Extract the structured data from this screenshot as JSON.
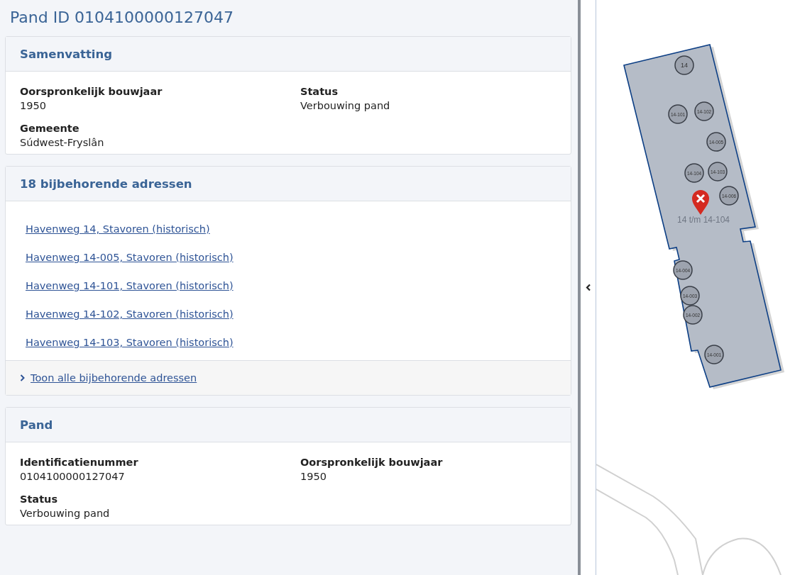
{
  "title": "Pand ID 0104100000127047",
  "sections": [
    {
      "title": "Samenvatting",
      "kind": "fields",
      "fields": [
        {
          "label": "Oorspronkelijk bouwjaar",
          "value": "1950"
        },
        {
          "label": "Status",
          "value": "Verbouwing pand"
        },
        {
          "label": "Gemeente",
          "value": "Súdwest-Fryslân"
        }
      ]
    },
    {
      "title": "18 bijbehorende adressen",
      "kind": "links",
      "links": [
        "Havenweg 14, Stavoren (historisch)",
        "Havenweg 14-005, Stavoren (historisch)",
        "Havenweg 14-101, Stavoren (historisch)",
        "Havenweg 14-102, Stavoren (historisch)",
        "Havenweg 14-103, Stavoren (historisch)"
      ],
      "footer_link": "Toon alle bijbehorende adressen"
    },
    {
      "title": "Pand",
      "kind": "fields",
      "fields": [
        {
          "label": "Identificatienummer",
          "value": "0104100000127047"
        },
        {
          "label": "Oorspronkelijk bouwjaar",
          "value": "1950"
        },
        {
          "label": "Status",
          "value": "Verbouwing pand"
        }
      ]
    }
  ],
  "map": {
    "label": "14 t/m 14-104",
    "addresses": [
      "14",
      "14-101",
      "14-102",
      "14-005",
      "14-104",
      "14-103",
      "14-006",
      "14-004",
      "14-003",
      "14-002",
      "14-001"
    ]
  }
}
